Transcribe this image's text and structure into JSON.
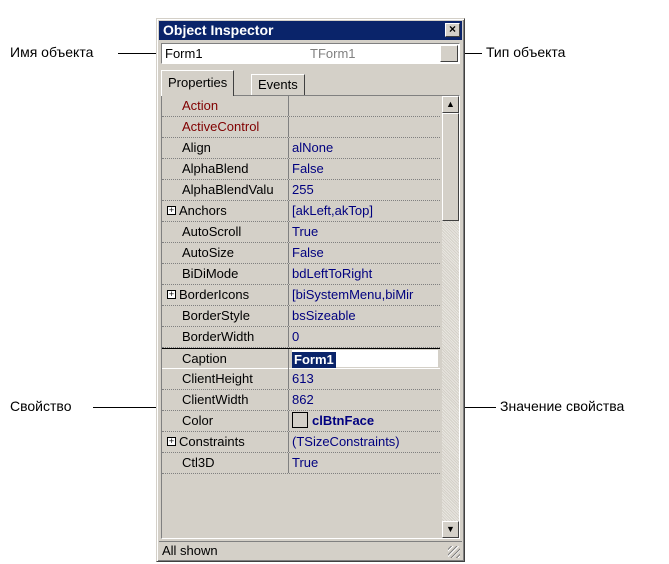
{
  "window": {
    "title": "Object Inspector",
    "close_glyph": "×"
  },
  "object_selector": {
    "name": "Form1",
    "type": "TForm1"
  },
  "tabs": [
    {
      "label": "Properties"
    },
    {
      "label": "Events"
    }
  ],
  "properties": [
    {
      "name": "Action",
      "value": ""
    },
    {
      "name": "ActiveControl",
      "value": ""
    },
    {
      "name": "Align",
      "value": "alNone"
    },
    {
      "name": "AlphaBlend",
      "value": "False"
    },
    {
      "name": "AlphaBlendValu",
      "value": "255"
    },
    {
      "name": "Anchors",
      "value": "[akLeft,akTop]"
    },
    {
      "name": "AutoScroll",
      "value": "True"
    },
    {
      "name": "AutoSize",
      "value": "False"
    },
    {
      "name": "BiDiMode",
      "value": "bdLeftToRight"
    },
    {
      "name": "BorderIcons",
      "value": "[biSystemMenu,biMir"
    },
    {
      "name": "BorderStyle",
      "value": "bsSizeable"
    },
    {
      "name": "BorderWidth",
      "value": "0"
    },
    {
      "name": "Caption",
      "value": "Form1"
    },
    {
      "name": "ClientHeight",
      "value": "613"
    },
    {
      "name": "ClientWidth",
      "value": "862"
    },
    {
      "name": "Color",
      "value": "clBtnFace"
    },
    {
      "name": "Constraints",
      "value": "(TSizeConstraints)"
    },
    {
      "name": "Ctl3D",
      "value": "True"
    }
  ],
  "status": "All shown",
  "annotations": {
    "object_name": "Имя объекта",
    "object_type": "Тип объекта",
    "property": "Свойство",
    "property_value": "Значение свойства"
  },
  "colors": {
    "titlebar": "#0a246a",
    "face": "#d4d0c8",
    "value_text": "#00007f",
    "event_link": "#800000"
  }
}
